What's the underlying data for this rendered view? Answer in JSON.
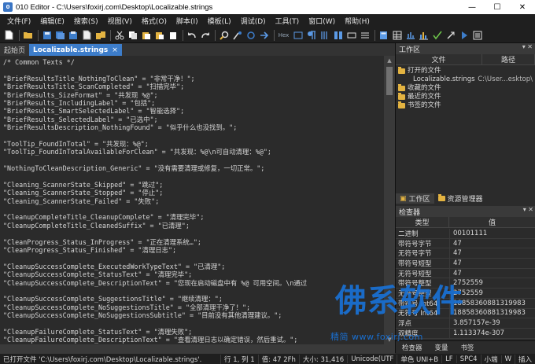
{
  "window": {
    "title": "010 Editor - C:\\Users\\foxirj.com\\Desktop\\Localizable.strings",
    "icon_letter": "0",
    "controls": [
      "—",
      "☐",
      "✕"
    ]
  },
  "menu": [
    "文件(F)",
    "编辑(E)",
    "搜索(S)",
    "视图(V)",
    "格式(O)",
    "脚本(I)",
    "模板(L)",
    "调试(D)",
    "工具(T)",
    "窗口(W)",
    "帮助(H)"
  ],
  "toolbar": {
    "hex_label": "Hex"
  },
  "tabs": [
    {
      "label": "起始页",
      "active": false
    },
    {
      "label": "Localizable.strings",
      "active": true,
      "close": "×"
    }
  ],
  "editor": {
    "lines": [
      "/* Common Texts */",
      "",
      "\"BriefResultsTitle_NothingToClean\" = \"非常干净！\";",
      "\"BriefResultsTitle_ScanCompleted\" = \"扫描完毕\";",
      "\"BriefResults_SizeFormat\" = \"共发现 %@\";",
      "\"BriefResults_IncludingLabel\" = \"包括\";",
      "\"BriefResults_SmartSelectedLabel\" = \"智能选择\";",
      "\"BriefResults_SelectedLabel\" = \"已选中\";",
      "\"BriefResultsDescription_NothingFound\" = \"似乎什么也没找到。\";",
      "",
      "\"ToolTip_FoundInTotal\" = \"共发现：%@\";",
      "\"ToolTip_FoundInTotalAvailableForClean\" = \"共发现：%@\\n可自动清理：%@\";",
      "",
      "\"NothingToCleanDescription_Generic\" = \"没有需要清理或修复，一切正常。\";",
      "",
      "\"Cleaning_ScannerState_Skipped\" = \"跳过\";",
      "\"Cleaning_ScannerState_Stopped\" = \"停止\";",
      "\"Cleaning_ScannerState_Failed\" = \"失败\";",
      "",
      "\"CleanupCompleteTitle_CleanupComplete\" = \"清理完毕\";",
      "\"CleanupCompleteTitle_CleanedSuffix\" = \"已清理\";",
      "",
      "\"CleanProgress_Status_InProgress\" = \"正在清理系统…\";",
      "\"CleanProgress_Status_Finished\" = \"清理日志\";",
      "",
      "\"CleanupSuccessComplete_ExecutedWorkTypeText\" = \"已清理\";",
      "\"CleanupSuccessComplete_StatusText\" = \"清理完毕\";",
      "\"CleanupSuccessComplete_DescriptionText\" = \"您现在启动磁盘中有 %@ 可用空间。\\n通过",
      "",
      "\"CleanupSuccessComplete_SuggestionsTitle\" = \"继续清理：\";",
      "\"CleanupSuccessComplete_NoSuggestionsTitle\" = \"全部清理干净了！\";",
      "\"CleanupSuccessComplete_NoSuggestionsSubtitle\" = \"目前没有其他清理建议。\";",
      "",
      "\"CleanupFailureComplete_StatusText\" = \"清理失败\";",
      "\"CleanupFailureComplete_DescriptionText\" = \"查看清理日志以确定错误，然后重试。\";"
    ]
  },
  "workspace": {
    "title": "工作区",
    "col_file": "文件",
    "col_path": "路径",
    "open_files": "打开的文件",
    "file_name": "Localizable.strings",
    "file_path": "C:\\User...esktop\\",
    "favorites": "收藏的文件",
    "recent": "最近的文件",
    "bookmarked": "书签的文件",
    "tab_workspace": "工作区",
    "tab_explorer": "资源管理器"
  },
  "inspector": {
    "title": "检查器",
    "col_type": "类型",
    "col_value": "值",
    "rows": [
      {
        "k": "二进制",
        "v": "00101111"
      },
      {
        "k": "带符号字节",
        "v": "47"
      },
      {
        "k": "无符号字节",
        "v": "47"
      },
      {
        "k": "带符号短型",
        "v": "47"
      },
      {
        "k": "无符号短型",
        "v": "47"
      },
      {
        "k": "带符号整型",
        "v": "2752559"
      },
      {
        "k": "无符号整型",
        "v": "2752559"
      },
      {
        "k": "带符号 Int64",
        "v": "18858360881319983"
      },
      {
        "k": "无符号 Int64",
        "v": "18858360881319983"
      },
      {
        "k": "浮点",
        "v": "3.857157e-39"
      },
      {
        "k": "双精度",
        "v": "1.113374e-307"
      }
    ],
    "bottom_tabs": [
      "检查器",
      "变量",
      "书签"
    ]
  },
  "status": {
    "file": "已打开文件 'C:\\Users\\foxirj.com\\Desktop\\Localizable.strings'.",
    "pos": "行 1, 列 1",
    "sel": "值: 47 2Fh",
    "size": "大小: 31,416",
    "enc": "Unicode(UTF",
    "enc2": "单色 UNI+B",
    "lf": "LF",
    "tab": "SPC4",
    "case": "小端",
    "mode": "W",
    "ins": "插入"
  },
  "watermark": {
    "main": "佛系软件",
    "sub": "精简  www.foxirj.com"
  },
  "colors": {
    "accent": "#3d7dca",
    "folder": "#e3b341",
    "watermark": "#1a6fd0"
  }
}
